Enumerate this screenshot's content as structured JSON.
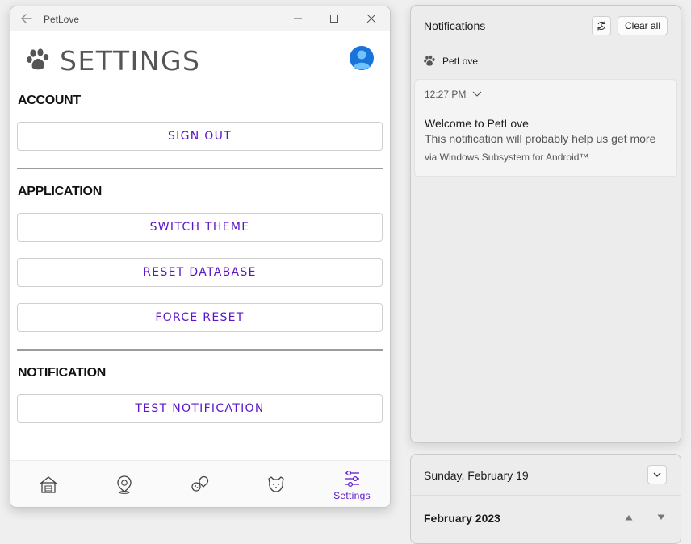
{
  "window": {
    "title": "PetLove"
  },
  "header": {
    "title": "SETTINGS"
  },
  "sections": {
    "account": {
      "heading": "ACCOUNT",
      "sign_out": "SIGN OUT"
    },
    "application": {
      "heading": "APPLICATION",
      "switch_theme": "SWITCH THEME",
      "reset_database": "RESET DATABASE",
      "force_reset": "FORCE RESET"
    },
    "notification": {
      "heading": "NOTIFICATION",
      "test_notification": "TEST NOTIFICATION"
    }
  },
  "bottom_nav": {
    "items": [
      {
        "icon": "house-icon"
      },
      {
        "icon": "location-pin-icon"
      },
      {
        "icon": "pet-toys-icon"
      },
      {
        "icon": "dog-cat-icon"
      },
      {
        "icon": "settings-sliders-icon",
        "label": "Settings",
        "active": true
      }
    ]
  },
  "notifications": {
    "title": "Notifications",
    "clear_all": "Clear all",
    "app_name": "PetLove",
    "toast": {
      "time": "12:27 PM",
      "title": "Welcome to PetLove",
      "body": "This notification will probably help us get more",
      "attribution": "via Windows Subsystem for Android™"
    }
  },
  "calendar": {
    "date": "Sunday, February 19",
    "month": "February 2023"
  },
  "colors": {
    "accent": "#5a16c8",
    "avatar": "#1a73d9"
  }
}
